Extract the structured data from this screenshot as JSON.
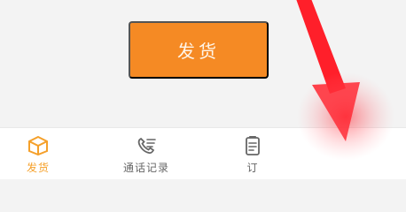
{
  "main": {
    "ship_button_label": "发货"
  },
  "bottom_nav": {
    "items": [
      {
        "label": "发货",
        "icon": "package-icon",
        "active": true
      },
      {
        "label": "通话记录",
        "icon": "phone-list-icon",
        "active": false
      },
      {
        "label": "订",
        "icon": "clipboard-icon",
        "active": false
      }
    ]
  },
  "colors": {
    "primary_button": "#f58a24",
    "active_tab": "#f5a02a",
    "inactive_tab": "#666666",
    "annotation_arrow": "#ff1f2a"
  }
}
